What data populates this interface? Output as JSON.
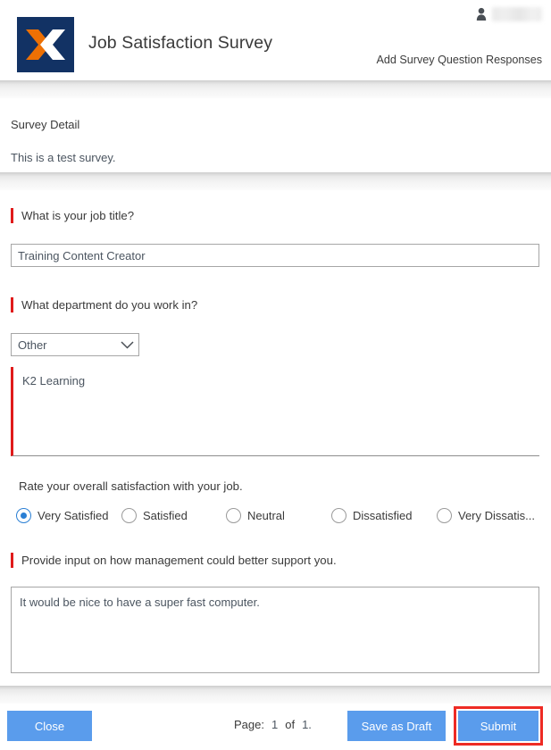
{
  "header": {
    "logo_icon": "k2-x-logo-icon",
    "title": "Job Satisfaction Survey",
    "user_icon": "person-icon",
    "user_name": "",
    "action_link": "Add Survey Question Responses",
    "logo_bg": "#123264",
    "logo_orange": "#ED7004",
    "logo_white": "#FFFFFF"
  },
  "detail": {
    "heading": "Survey Detail",
    "description": "This is a test survey."
  },
  "questions": [
    {
      "label": "What is your job title?",
      "required": true,
      "type": "text",
      "value": "Training Content Creator",
      "placeholder": ""
    },
    {
      "label": "What department do you work in?",
      "required": true,
      "type": "select",
      "value": "Other",
      "chevron_icon": "chevron-down-icon"
    },
    {
      "label": "",
      "required": true,
      "type": "open-area",
      "value": "K2 Learning"
    },
    {
      "label": "Rate your overall satisfaction with your job.",
      "required": false,
      "type": "radio",
      "options": [
        {
          "label": "Very Satisfied",
          "selected": true
        },
        {
          "label": "Satisfied",
          "selected": false
        },
        {
          "label": "Neutral",
          "selected": false
        },
        {
          "label": "Dissatisfied",
          "selected": false
        },
        {
          "label": "Very Dissatis...",
          "selected": false
        }
      ]
    },
    {
      "label": "Provide input on how management could better support you.",
      "required": true,
      "type": "textarea",
      "value": "It would be nice to have a super fast computer."
    }
  ],
  "footer": {
    "close_label": "Close",
    "save_draft_label": "Save as Draft",
    "submit_label": "Submit",
    "pager_label": "Page:",
    "pager_current": "1",
    "pager_of": "of",
    "pager_total": "1.",
    "button_color": "#5A9CEC",
    "highlight_color": "#EE2B24"
  }
}
